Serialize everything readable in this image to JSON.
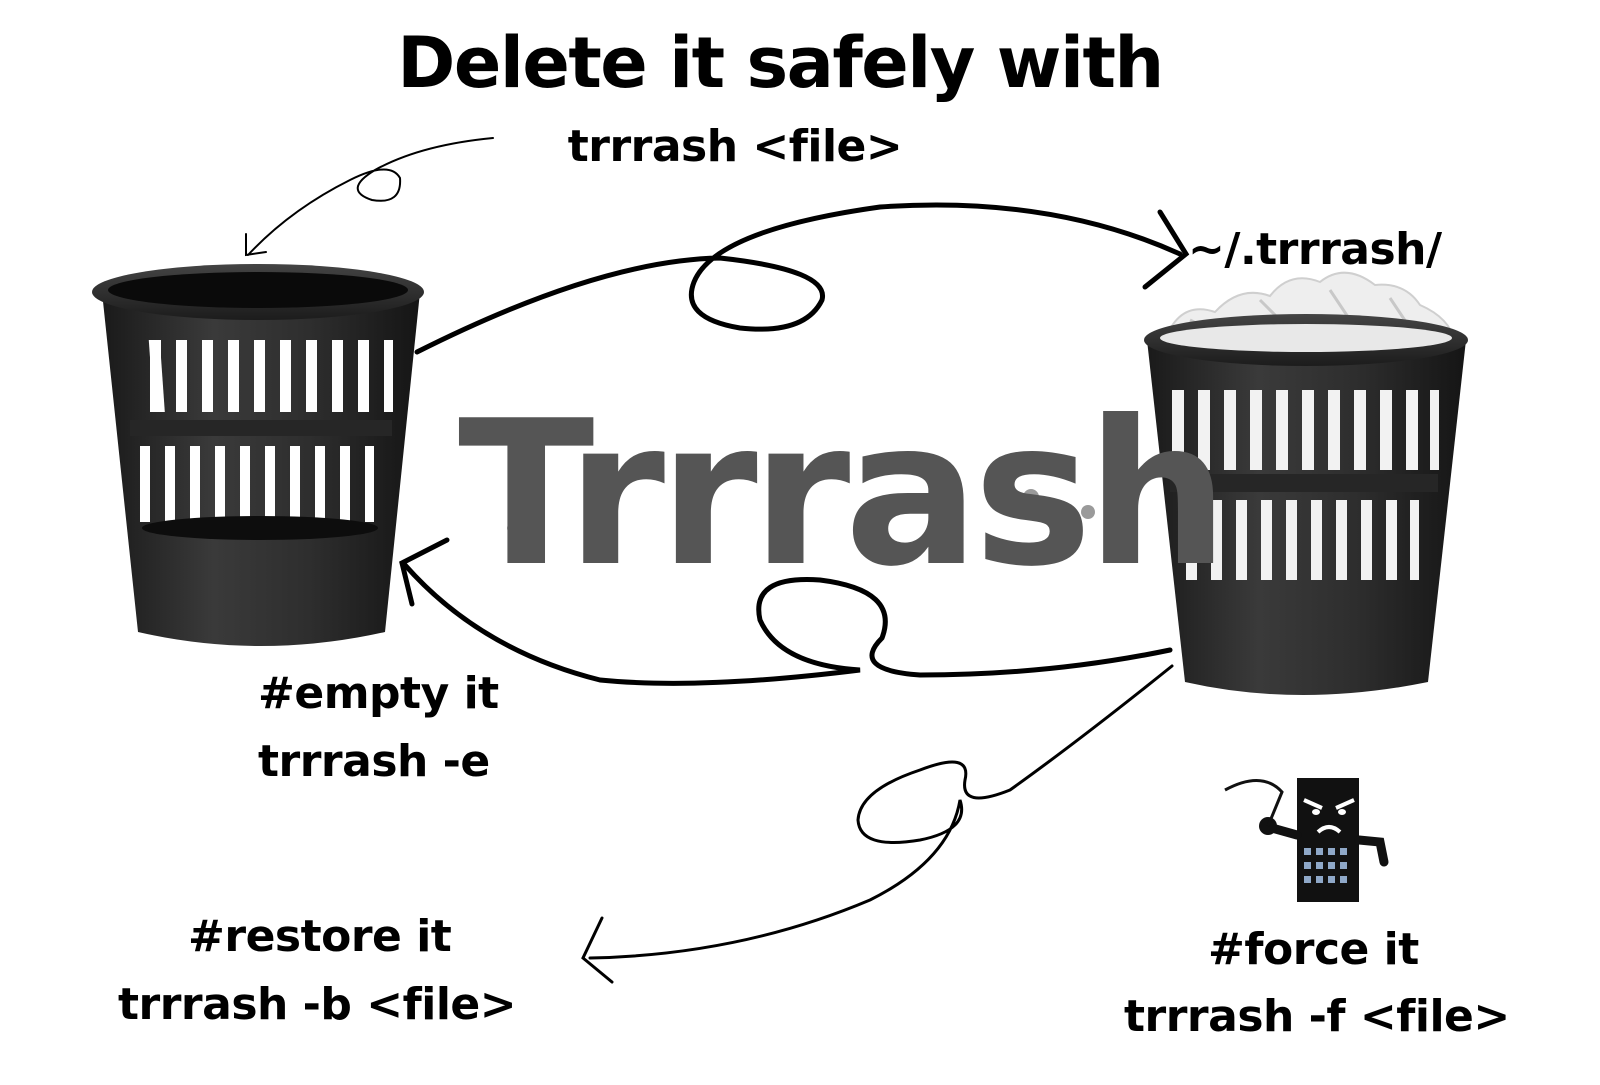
{
  "headline": {
    "title": "Delete it safely with",
    "command": "trrrash <file>"
  },
  "trash_location": "~/.trrrash/",
  "brand": "Trrrash",
  "actions": {
    "empty": {
      "title": "#empty it",
      "command": "trrrash -e"
    },
    "restore": {
      "title": "#restore it",
      "command": "trrrash -b <file>"
    },
    "force": {
      "title": "#force it",
      "command": "trrrash -f <file>"
    }
  },
  "icons": [
    "empty-trash-bin-icon",
    "full-trash-bin-icon",
    "angry-building-with-whip-icon"
  ],
  "colors": {
    "text": "#000000",
    "brand_text": "#555555",
    "bin": "#2b2b2b",
    "paper": "#eeeeee",
    "background": "#ffffff"
  }
}
